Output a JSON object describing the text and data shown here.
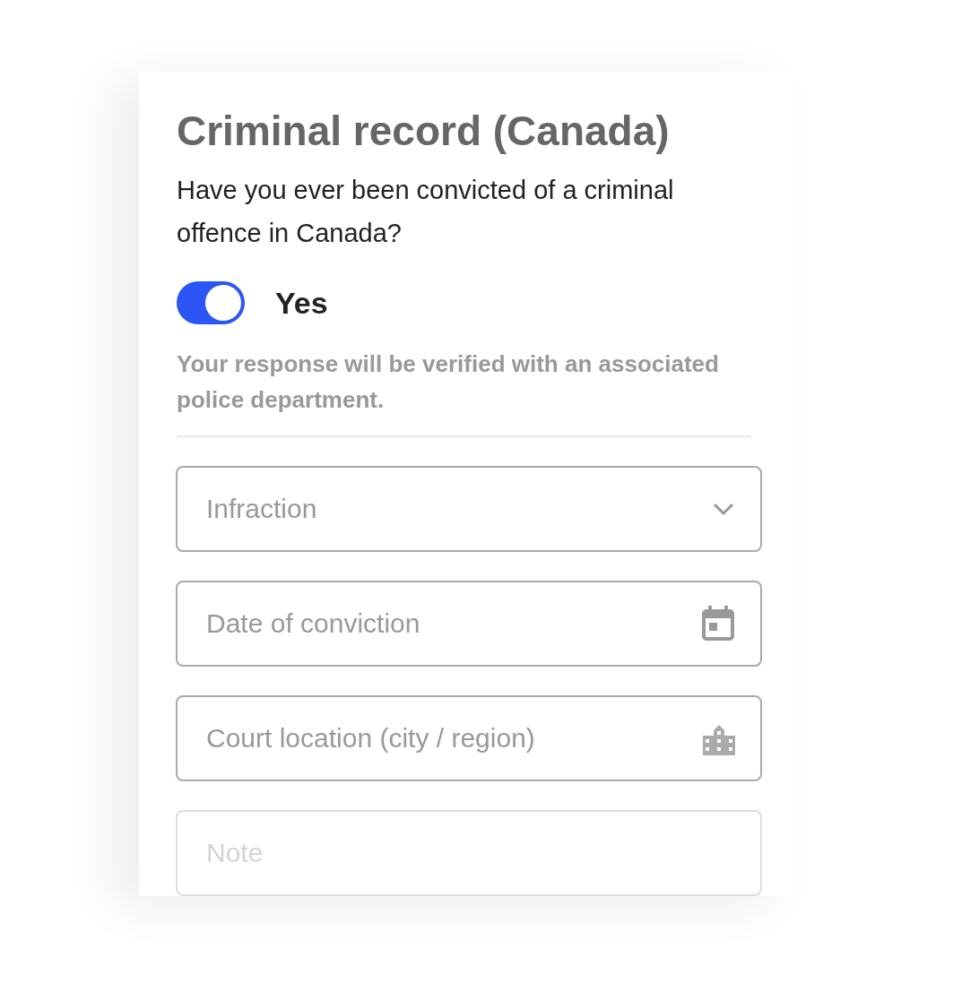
{
  "title": "Criminal record (Canada)",
  "question": "Have you ever been convicted of a criminal offence in Canada?",
  "answer": {
    "label": "Yes",
    "on": true
  },
  "hint": "Your response will be verified with an associated police department.",
  "fields": [
    {
      "kind": "select",
      "placeholder": "Infraction"
    },
    {
      "kind": "date",
      "placeholder": "Date of conviction"
    },
    {
      "kind": "location",
      "placeholder": "Court location (city / region)"
    },
    {
      "kind": "text",
      "placeholder": "Note"
    }
  ]
}
